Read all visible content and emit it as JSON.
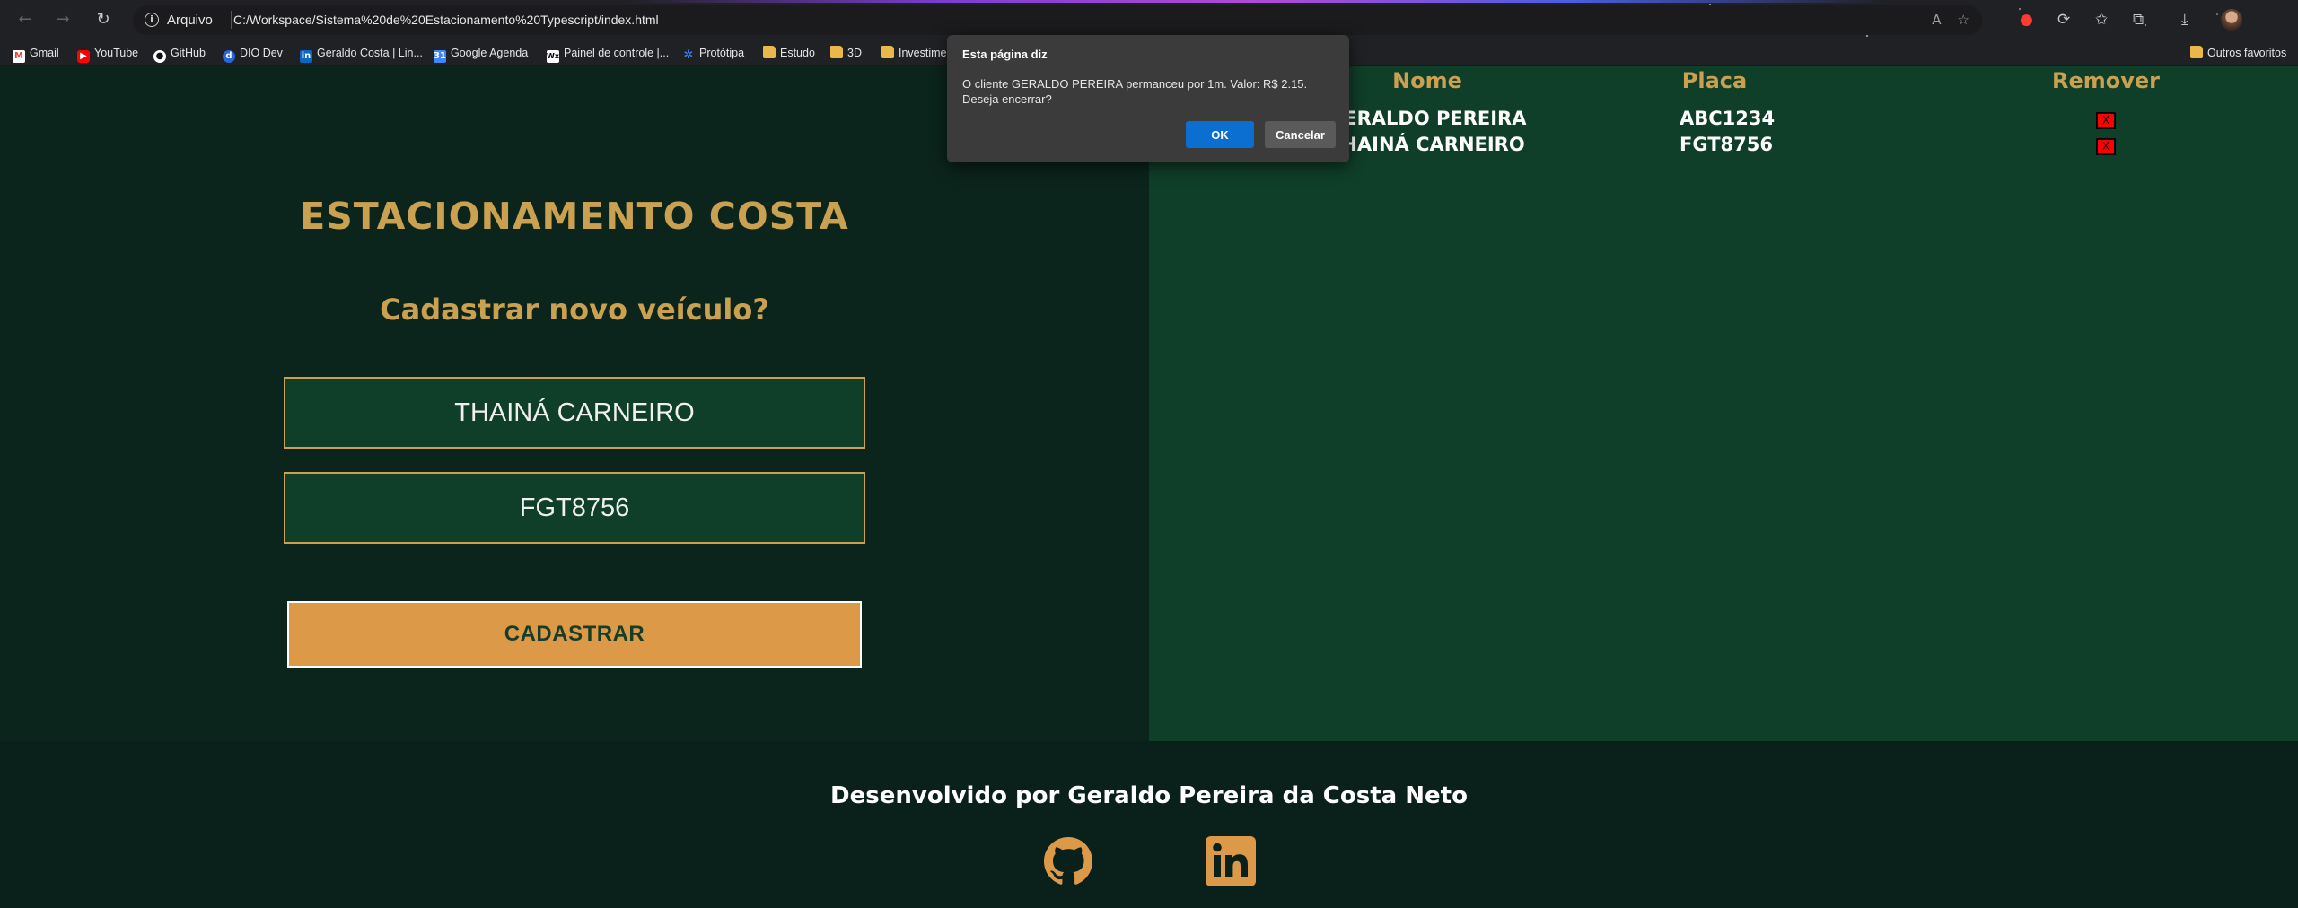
{
  "browser": {
    "address_scheme": "Arquivo",
    "url": "C:/Workspace/Sistema%20de%20Estacionamento%20Typescript/index.html",
    "bookmarks": [
      {
        "label": "Gmail",
        "icon": "gmail-icon"
      },
      {
        "label": "YouTube",
        "icon": "youtube-icon"
      },
      {
        "label": "GitHub",
        "icon": "github-icon"
      },
      {
        "label": "DIO Dev",
        "icon": "dio-icon"
      },
      {
        "label": "Geraldo Costa | Lin...",
        "icon": "linkedin-icon"
      },
      {
        "label": "Google Agenda",
        "icon": "calendar-icon"
      },
      {
        "label": "Painel de controle |...",
        "icon": "wix-icon"
      },
      {
        "label": "Protótipa",
        "icon": "prototipa-icon"
      },
      {
        "label": "Estudo",
        "icon": "folder-icon"
      },
      {
        "label": "3D",
        "icon": "folder-icon"
      },
      {
        "label": "Investime",
        "icon": "folder-icon"
      }
    ],
    "other_bookmarks": "Outros favoritos"
  },
  "page": {
    "title": "ESTACIONAMENTO COSTA",
    "subtitle": "Cadastrar novo veículo?",
    "name_input_value": "THAINÁ CARNEIRO",
    "plate_input_value": "FGT8756",
    "submit_label": "CADASTRAR",
    "table": {
      "headers": {
        "name": "Nome",
        "plate": "Placa",
        "remove": "Remover"
      },
      "rows": [
        {
          "name": "GERALDO PEREIRA",
          "plate": "ABC1234",
          "remove": "X"
        },
        {
          "name": "THAINÁ CARNEIRO",
          "plate": "FGT8756",
          "remove": "X"
        }
      ]
    },
    "footer": "Desenvolvido por Geraldo Pereira da Costa Neto",
    "social_icons": [
      "github-icon",
      "linkedin-icon"
    ]
  },
  "dialog": {
    "title": "Esta página diz",
    "message": "O cliente GERALDO PEREIRA permanceu por 1m. Valor: R$ 2.15. Deseja encerrar?",
    "ok_label": "OK",
    "cancel_label": "Cancelar"
  },
  "colors": {
    "gold": "#c9a150",
    "button_orange": "#dc9a49",
    "left_panel": "#0b241c",
    "right_panel": "#0f3e29",
    "remove_red": "#ff0000"
  }
}
